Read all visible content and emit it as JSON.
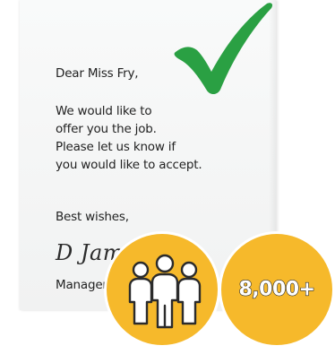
{
  "letter": {
    "salutation": "Dear Miss Fry,",
    "body_lines": [
      "We would like to",
      "offer you the job.",
      "Please let us know if",
      "you would like to accept."
    ],
    "closing": "Best wishes,",
    "signature": "D James",
    "role": "Manager"
  },
  "badges": {
    "people_icon": "people-group-icon",
    "count": "8,000+"
  },
  "icons": {
    "checkmark": "checkmark-icon"
  },
  "colors": {
    "checkmark": "#2aa043",
    "badge_fill": "#f6b92b",
    "outline": "#2b2b2b"
  }
}
